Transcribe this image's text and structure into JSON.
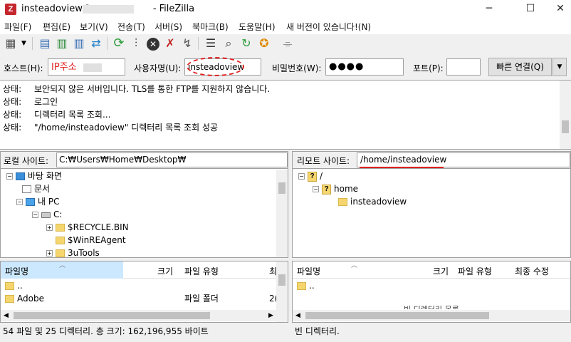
{
  "window": {
    "title_prefix": "insteadoview@",
    "title_suffix": "- FileZilla",
    "app_icon": "Z"
  },
  "menu": [
    "파일(F)",
    "편집(E)",
    "보기(V)",
    "전송(T)",
    "서버(S)",
    "북마크(B)",
    "도움말(H)",
    "새 버전이 있습니다!(N)"
  ],
  "quickconnect": {
    "host_label": "호스트(H):",
    "host_value": "IP주소",
    "user_label": "사용자명(U):",
    "user_value": "insteadoview",
    "pass_label": "비밀번호(W):",
    "pass_value": "●●●●",
    "port_label": "포트(P):",
    "port_value": "",
    "connect_label": "빠른 연결(Q)",
    "dropdown": "▼"
  },
  "log": [
    {
      "label": "상태:",
      "text": "보안되지 않은 서버입니다. TLS를 통한 FTP를 지원하지 않습니다."
    },
    {
      "label": "상태:",
      "text": "로그인"
    },
    {
      "label": "상태:",
      "text": "디렉터리 목록 조회..."
    },
    {
      "label": "상태:",
      "text": "\"/home/insteadoview\" 디렉터리 목록 조회 성공"
    }
  ],
  "local": {
    "site_label": "로컬 사이트:",
    "path": "C:₩Users₩Home₩Desktop₩",
    "tree": [
      "바탕 화면",
      "문서",
      "내 PC",
      "C:",
      "$RECYCLE.BIN",
      "$WinREAgent",
      "3uTools"
    ],
    "columns": [
      "파일명",
      "크기",
      "파일 유형",
      "최"
    ],
    "files": [
      {
        "name": "..",
        "size": "",
        "type": ""
      },
      {
        "name": "Adobe",
        "size": "",
        "type": "파일 폴더",
        "extra": "2("
      }
    ],
    "status": "54 파일 및 25 디렉터리. 총 크기: 162,196,955 바이트"
  },
  "remote": {
    "site_label": "리모트 사이트:",
    "path": "/home/insteadoview",
    "tree": [
      "/",
      "home",
      "insteadoview"
    ],
    "columns": [
      "파일명",
      "크기",
      "파일 유형",
      "최종 수정"
    ],
    "files": [
      {
        "name": ".."
      }
    ],
    "empty_notice": "빈 디렉터리 목록",
    "status": "빈 디렉터리."
  },
  "colors": {
    "annotation_red": "#e02020",
    "highlight": "#cce8ff"
  }
}
